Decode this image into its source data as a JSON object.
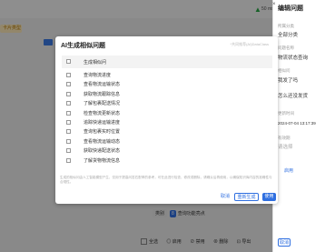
{
  "status": {
    "wifi_label": "50 ms"
  },
  "background": {
    "chip": "卡片类型"
  },
  "right_panel": {
    "title": "编辑问题",
    "fields": [
      {
        "label": "所属分类",
        "value": "全部分类"
      },
      {
        "label": "问题名称",
        "value": "物流状态查询"
      },
      {
        "label": "相似问",
        "value": "我发了吗"
      },
      {
        "label": "",
        "value": "怎么还没发货"
      },
      {
        "label": "更新时间",
        "value": "2024-07-04 13:17:39"
      },
      {
        "label": "有效期",
        "value": "请选择"
      }
    ],
    "link": "启用",
    "cancel": "取消"
  },
  "below": {
    "tag": "类别",
    "count": "8",
    "label": "查询功能亮点"
  },
  "bottom_bar": {
    "select_all": "全选",
    "enable": "启用",
    "disable": "禁用",
    "delete": "删除",
    "export": "导出"
  },
  "modal": {
    "title": "AI生成相似问题",
    "hint": "*共同推荐(AI)DataClass",
    "header": "生成相似问",
    "rows": [
      "查询物流进度",
      "查看物流运输状态",
      "获取物流跟踪信息",
      "了解包裹配送情况",
      "检查物流更新状态",
      "追踪快递运输进度",
      "查询包裹实时位置",
      "查看物流运输动态",
      "获取快递配送状态",
      "了解货物物流信息"
    ],
    "footnote": "生成的相似问由人工智能模型产生，仅用于提高问答匹配率的参考，可在此进行检查、修改或删除，请确认后再使用，以确保知识库内容的准确性与合规性。",
    "cancel": "取消",
    "regenerate": "重新生成",
    "use": "使用"
  }
}
